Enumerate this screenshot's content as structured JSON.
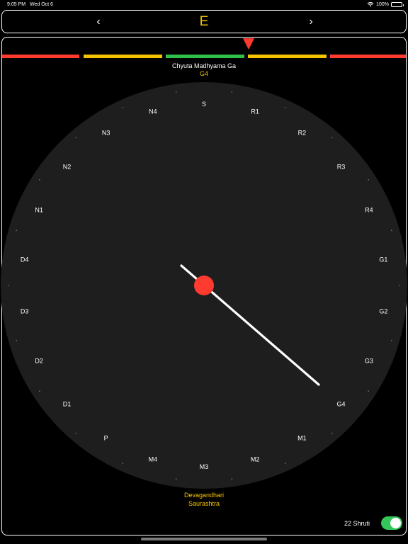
{
  "status_bar": {
    "time": "9:05 PM",
    "date": "Wed Oct 6",
    "battery": "100%"
  },
  "key_selector": {
    "prev_glyph": "‹",
    "next_glyph": "›",
    "current_key": "E"
  },
  "tuner": {
    "note_name": "Chyuta Madhyama Ga",
    "note_code": "G4",
    "meter_colors": [
      "#ff3b30",
      "#f5c400",
      "#2fbf4a",
      "#f5c400",
      "#ff3b30"
    ]
  },
  "dial": {
    "labels": [
      "S",
      "R1",
      "R2",
      "R3",
      "R4",
      "G1",
      "G2",
      "G3",
      "G4",
      "M1",
      "M2",
      "M3",
      "M4",
      "P",
      "D1",
      "D2",
      "D3",
      "D4",
      "N1",
      "N2",
      "N3",
      "N4"
    ],
    "needle_color": "#ffffff",
    "hub_color": "#ff3b30",
    "face_color": "#1e1e1e"
  },
  "raga": {
    "line1": "Devagandhari",
    "line2": "Saurashtra"
  },
  "shruti_toggle": {
    "label": "22 Shruti",
    "on": true
  }
}
